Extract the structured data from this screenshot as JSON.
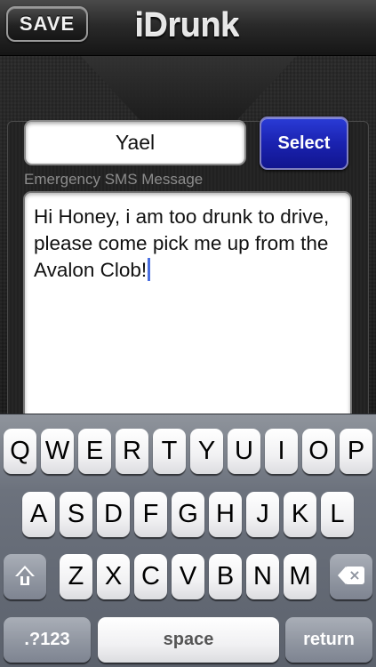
{
  "header": {
    "save_label": "SAVE",
    "title": "iDrunk"
  },
  "contact": {
    "name_value": "Yael",
    "select_label": "Select"
  },
  "sms": {
    "label": "Emergency SMS Message",
    "message": "Hi Honey, i am too drunk to drive, please come pick me up from the Avalon Clob!"
  },
  "keyboard": {
    "row1": [
      "Q",
      "W",
      "E",
      "R",
      "T",
      "Y",
      "U",
      "I",
      "O",
      "P"
    ],
    "row2": [
      "A",
      "S",
      "D",
      "F",
      "G",
      "H",
      "J",
      "K",
      "L"
    ],
    "row3": [
      "Z",
      "X",
      "C",
      "V",
      "B",
      "N",
      "M"
    ],
    "numbers_label": ".?123",
    "space_label": "space",
    "return_label": "return",
    "shift_icon": "shift-icon",
    "backspace_icon": "backspace-icon"
  },
  "colors": {
    "select_button": "#1a22b0",
    "caret": "#4a6fe0",
    "label_gray": "#8c8c8c"
  }
}
